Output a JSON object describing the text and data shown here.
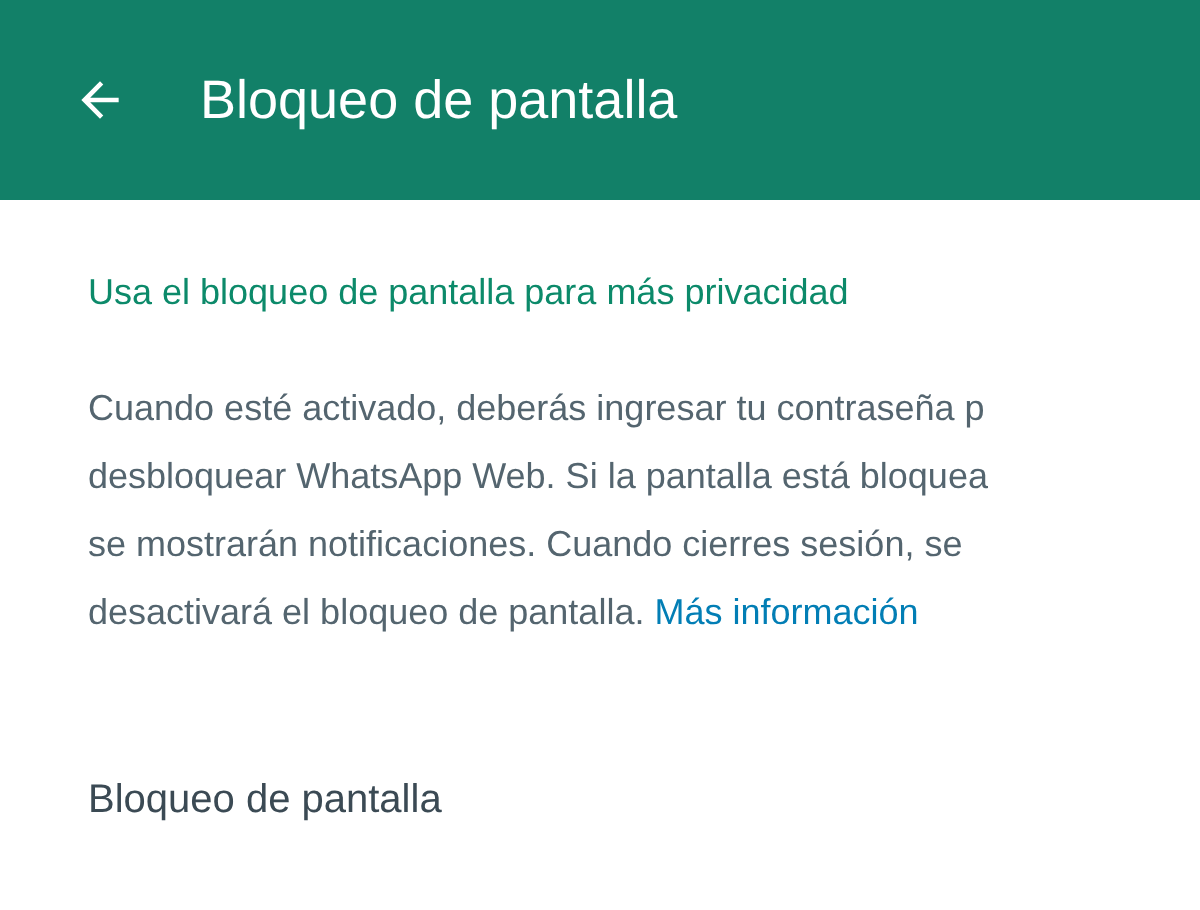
{
  "header": {
    "title": "Bloqueo de pantalla"
  },
  "subtitle": "Usa el bloqueo de pantalla para más privacidad",
  "description": {
    "lines": [
      "Cuando esté activado, deberás ingresar tu contraseña p",
      "desbloquear WhatsApp Web. Si la pantalla está bloquea",
      "se mostrarán notificaciones. Cuando cierres sesión, se",
      "desactivará el bloqueo de pantalla."
    ],
    "link": "Más información"
  },
  "setting": {
    "label": "Bloqueo de pantalla"
  }
}
